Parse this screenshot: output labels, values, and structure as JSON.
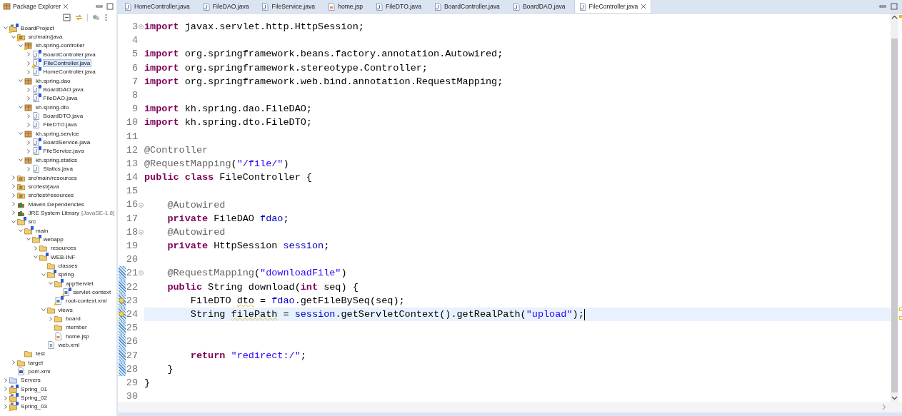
{
  "package_explorer": {
    "title": "Package Explorer",
    "tree": [
      {
        "label": "BoardProject",
        "kind": "project",
        "expanded": true,
        "selected": false,
        "spring": true,
        "warning": true,
        "children": [
          {
            "label": "src/main/java",
            "kind": "srcfolder",
            "expanded": true,
            "selected": false,
            "spring": false,
            "warning": true,
            "children": [
              {
                "label": "kh.spring.controller",
                "kind": "package",
                "expanded": true,
                "selected": false,
                "spring": false,
                "warning": true,
                "children": [
                  {
                    "label": "BoardController.java",
                    "kind": "java",
                    "expanded": false,
                    "selected": false,
                    "spring": true,
                    "warning": false
                  },
                  {
                    "label": "FileController.java",
                    "kind": "java",
                    "expanded": false,
                    "selected": true,
                    "spring": true,
                    "warning": true
                  },
                  {
                    "label": "HomeController.java",
                    "kind": "java",
                    "expanded": false,
                    "selected": false,
                    "spring": true,
                    "warning": false
                  }
                ]
              },
              {
                "label": "kh.spring.dao",
                "kind": "package",
                "expanded": true,
                "selected": false,
                "spring": false,
                "warning": false,
                "children": [
                  {
                    "label": "BoardDAO.java",
                    "kind": "java",
                    "expanded": false,
                    "selected": false,
                    "spring": true,
                    "warning": false
                  },
                  {
                    "label": "FileDAO.java",
                    "kind": "java",
                    "expanded": false,
                    "selected": false,
                    "spring": true,
                    "warning": false
                  }
                ]
              },
              {
                "label": "kh.spring.dto",
                "kind": "package",
                "expanded": true,
                "selected": false,
                "spring": false,
                "warning": false,
                "children": [
                  {
                    "label": "BoardDTO.java",
                    "kind": "java",
                    "expanded": false,
                    "selected": false,
                    "spring": false,
                    "warning": false
                  },
                  {
                    "label": "FileDTO.java",
                    "kind": "java",
                    "expanded": false,
                    "selected": false,
                    "spring": false,
                    "warning": false
                  }
                ]
              },
              {
                "label": "kh.spring.service",
                "kind": "package",
                "expanded": true,
                "selected": false,
                "spring": false,
                "warning": false,
                "children": [
                  {
                    "label": "BoardService.java",
                    "kind": "java",
                    "expanded": false,
                    "selected": false,
                    "spring": true,
                    "warning": false
                  },
                  {
                    "label": "FileService.java",
                    "kind": "java",
                    "expanded": false,
                    "selected": false,
                    "spring": true,
                    "warning": false
                  }
                ]
              },
              {
                "label": "kh.spring.statics",
                "kind": "package",
                "expanded": true,
                "selected": false,
                "spring": false,
                "warning": false,
                "children": [
                  {
                    "label": "Statics.java",
                    "kind": "java",
                    "expanded": false,
                    "selected": false,
                    "spring": false,
                    "warning": false
                  }
                ]
              }
            ]
          },
          {
            "label": "src/main/resources",
            "kind": "srcfolder",
            "expanded": false,
            "selected": false,
            "spring": false,
            "warning": false
          },
          {
            "label": "src/test/java",
            "kind": "srcfolder",
            "expanded": false,
            "selected": false,
            "spring": false,
            "warning": false
          },
          {
            "label": "src/test/resources",
            "kind": "srcfolder",
            "expanded": false,
            "selected": false,
            "spring": false,
            "warning": false
          },
          {
            "label": "Maven Dependencies",
            "kind": "library",
            "expanded": false,
            "selected": false,
            "spring": false,
            "warning": false
          },
          {
            "label": "JRE System Library",
            "decoration": "[JavaSE-1.8]",
            "kind": "library",
            "expanded": false,
            "selected": false,
            "spring": false,
            "warning": false
          },
          {
            "label": "src",
            "kind": "folder",
            "expanded": true,
            "selected": false,
            "spring": true,
            "warning": false,
            "children": [
              {
                "label": "main",
                "kind": "folder",
                "expanded": true,
                "selected": false,
                "spring": true,
                "warning": false,
                "children": [
                  {
                    "label": "webapp",
                    "kind": "folder",
                    "expanded": true,
                    "selected": false,
                    "spring": true,
                    "warning": false,
                    "children": [
                      {
                        "label": "resources",
                        "kind": "folder",
                        "expanded": false,
                        "selected": false,
                        "spring": false,
                        "warning": false
                      },
                      {
                        "label": "WEB-INF",
                        "kind": "folder",
                        "expanded": true,
                        "selected": false,
                        "spring": true,
                        "warning": false,
                        "children": [
                          {
                            "label": "classes",
                            "kind": "folder",
                            "selected": false,
                            "spring": false,
                            "warning": false
                          },
                          {
                            "label": "spring",
                            "kind": "folder",
                            "expanded": true,
                            "selected": false,
                            "spring": true,
                            "warning": false,
                            "children": [
                              {
                                "label": "appServlet",
                                "kind": "folder",
                                "expanded": true,
                                "selected": false,
                                "spring": true,
                                "warning": false,
                                "children": [
                                  {
                                    "label": "servlet-context",
                                    "kind": "xml",
                                    "selected": false,
                                    "spring": true,
                                    "warning": true
                                  }
                                ]
                              },
                              {
                                "label": "root-context.xml",
                                "kind": "xml",
                                "selected": false,
                                "spring": true,
                                "warning": true
                              }
                            ]
                          },
                          {
                            "label": "views",
                            "kind": "folder",
                            "expanded": true,
                            "selected": false,
                            "spring": false,
                            "warning": false,
                            "children": [
                              {
                                "label": "board",
                                "kind": "folder",
                                "expanded": false,
                                "selected": false,
                                "spring": false,
                                "warning": false
                              },
                              {
                                "label": "member",
                                "kind": "folder",
                                "selected": false,
                                "spring": false,
                                "warning": false
                              },
                              {
                                "label": "home.jsp",
                                "kind": "jsp",
                                "selected": false,
                                "spring": false,
                                "warning": false
                              }
                            ]
                          },
                          {
                            "label": "web.xml",
                            "kind": "webxml",
                            "selected": false,
                            "spring": false,
                            "warning": false
                          }
                        ]
                      }
                    ]
                  }
                ]
              },
              {
                "label": "test",
                "kind": "folder",
                "selected": false,
                "spring": false,
                "warning": false
              }
            ]
          },
          {
            "label": "target",
            "kind": "folder",
            "expanded": false,
            "selected": false,
            "spring": false,
            "warning": false
          },
          {
            "label": "pom.xml",
            "kind": "pom",
            "selected": false,
            "spring": false,
            "warning": false
          }
        ]
      },
      {
        "label": "Servers",
        "kind": "servers",
        "expanded": false,
        "selected": false,
        "spring": false,
        "warning": false
      },
      {
        "label": "Spring_01",
        "kind": "project",
        "expanded": false,
        "selected": false,
        "spring": true,
        "warning": true
      },
      {
        "label": "Spring_02",
        "kind": "project",
        "expanded": false,
        "selected": false,
        "spring": true,
        "warning": true
      },
      {
        "label": "Spring_03",
        "kind": "project",
        "expanded": false,
        "selected": false,
        "spring": true,
        "warning": true
      }
    ]
  },
  "editor": {
    "tabs": [
      {
        "label": "HomeController.java",
        "kind": "java",
        "selected": false
      },
      {
        "label": "FileDAO.java",
        "kind": "java",
        "selected": false
      },
      {
        "label": "FileService.java",
        "kind": "java",
        "selected": false
      },
      {
        "label": "home.jsp",
        "kind": "jsp",
        "selected": false
      },
      {
        "label": "FileDTO.java",
        "kind": "java",
        "selected": false
      },
      {
        "label": "BoardController.java",
        "kind": "java",
        "selected": false
      },
      {
        "label": "BoardDAO.java",
        "kind": "java",
        "selected": false
      },
      {
        "label": "FileController.java",
        "kind": "java",
        "selected": true
      }
    ],
    "lines": [
      {
        "number": "3",
        "fold": true,
        "changed": false,
        "warning": false,
        "current": false,
        "tokens": [
          {
            "kind": "keyword",
            "text": "import"
          },
          {
            "kind": "plain",
            "text": " javax.servlet.http.HttpSession;"
          }
        ]
      },
      {
        "number": "4",
        "fold": false,
        "changed": false,
        "warning": false,
        "current": false
      },
      {
        "number": "5",
        "fold": false,
        "changed": false,
        "warning": false,
        "current": false,
        "tokens": [
          {
            "kind": "keyword",
            "text": "import"
          },
          {
            "kind": "plain",
            "text": " org.springframework.beans.factory.annotation.Autowired;"
          }
        ]
      },
      {
        "number": "6",
        "fold": false,
        "changed": false,
        "warning": false,
        "current": false,
        "tokens": [
          {
            "kind": "keyword",
            "text": "import"
          },
          {
            "kind": "plain",
            "text": " org.springframework.stereotype.Controller;"
          }
        ]
      },
      {
        "number": "7",
        "fold": false,
        "changed": false,
        "warning": false,
        "current": false,
        "tokens": [
          {
            "kind": "keyword",
            "text": "import"
          },
          {
            "kind": "plain",
            "text": " org.springframework.web.bind.annotation.RequestMapping;"
          }
        ]
      },
      {
        "number": "8",
        "fold": false,
        "changed": false,
        "warning": false,
        "current": false
      },
      {
        "number": "9",
        "fold": false,
        "changed": false,
        "warning": false,
        "current": false,
        "tokens": [
          {
            "kind": "keyword",
            "text": "import"
          },
          {
            "kind": "plain",
            "text": " kh.spring.dao.FileDAO;"
          }
        ]
      },
      {
        "number": "10",
        "fold": false,
        "changed": false,
        "warning": false,
        "current": false,
        "tokens": [
          {
            "kind": "keyword",
            "text": "import"
          },
          {
            "kind": "plain",
            "text": " kh.spring.dto.FileDTO;"
          }
        ]
      },
      {
        "number": "11",
        "fold": false,
        "changed": false,
        "warning": false,
        "current": false
      },
      {
        "number": "12",
        "fold": false,
        "changed": false,
        "warning": false,
        "current": false,
        "tokens": [
          {
            "kind": "annotation",
            "text": "@Controller"
          }
        ]
      },
      {
        "number": "13",
        "fold": false,
        "changed": false,
        "warning": false,
        "current": false,
        "tokens": [
          {
            "kind": "annotation",
            "text": "@RequestMapping"
          },
          {
            "kind": "plain",
            "text": "("
          },
          {
            "kind": "string",
            "text": "\"/file/\""
          },
          {
            "kind": "plain",
            "text": ")"
          }
        ]
      },
      {
        "number": "14",
        "fold": false,
        "changed": false,
        "warning": false,
        "current": false,
        "tokens": [
          {
            "kind": "keyword",
            "text": "public"
          },
          {
            "kind": "keyword",
            "text": " class"
          },
          {
            "kind": "plain",
            "text": " FileController {"
          }
        ]
      },
      {
        "number": "15",
        "fold": false,
        "changed": false,
        "warning": false,
        "current": false
      },
      {
        "number": "16",
        "fold": true,
        "changed": false,
        "warning": false,
        "current": false,
        "tokens": [
          {
            "kind": "annotation",
            "text": "    @Autowired"
          }
        ]
      },
      {
        "number": "17",
        "fold": false,
        "changed": false,
        "warning": false,
        "current": false,
        "tokens": [
          {
            "kind": "keyword",
            "text": "    private"
          },
          {
            "kind": "plain",
            "text": " FileDAO "
          },
          {
            "kind": "field",
            "text": "fdao"
          },
          {
            "kind": "plain",
            "text": ";"
          }
        ]
      },
      {
        "number": "18",
        "fold": true,
        "changed": false,
        "warning": false,
        "current": false,
        "tokens": [
          {
            "kind": "annotation",
            "text": "    @Autowired"
          }
        ]
      },
      {
        "number": "19",
        "fold": false,
        "changed": false,
        "warning": false,
        "current": false,
        "tokens": [
          {
            "kind": "keyword",
            "text": "    private"
          },
          {
            "kind": "plain",
            "text": " HttpSession "
          },
          {
            "kind": "field",
            "text": "session"
          },
          {
            "kind": "plain",
            "text": ";"
          }
        ]
      },
      {
        "number": "20",
        "fold": false,
        "changed": false,
        "warning": false,
        "current": false
      },
      {
        "number": "21",
        "fold": true,
        "changed": true,
        "warning": false,
        "current": false,
        "tokens": [
          {
            "kind": "annotation",
            "text": "    @RequestMapping"
          },
          {
            "kind": "plain",
            "text": "("
          },
          {
            "kind": "string",
            "text": "\"downloadFile\""
          },
          {
            "kind": "plain",
            "text": ")"
          }
        ]
      },
      {
        "number": "22",
        "fold": false,
        "changed": true,
        "warning": false,
        "current": false,
        "tokens": [
          {
            "kind": "keyword",
            "text": "    public"
          },
          {
            "kind": "plain",
            "text": " String download("
          },
          {
            "kind": "keyword",
            "text": "int"
          },
          {
            "kind": "plain",
            "text": " seq) {"
          }
        ]
      },
      {
        "number": "23",
        "fold": false,
        "changed": true,
        "warning": true,
        "current": false,
        "tokens": [
          {
            "kind": "plain",
            "text": "        FileDTO "
          },
          {
            "kind": "unused",
            "text": "dto"
          },
          {
            "kind": "plain",
            "text": " = "
          },
          {
            "kind": "field",
            "text": "fdao"
          },
          {
            "kind": "plain",
            "text": ".getFileBySeq(seq);"
          }
        ]
      },
      {
        "number": "24",
        "fold": false,
        "changed": true,
        "warning": true,
        "current": true,
        "tokens": [
          {
            "kind": "plain",
            "text": "        String "
          },
          {
            "kind": "unused",
            "text": "filePath"
          },
          {
            "kind": "plain",
            "text": " = "
          },
          {
            "kind": "field",
            "text": "session"
          },
          {
            "kind": "plain",
            "text": ".getServletContext().getRealPath("
          },
          {
            "kind": "string",
            "text": "\"upload\""
          },
          {
            "kind": "plain",
            "text": ");"
          }
        ]
      },
      {
        "number": "25",
        "fold": false,
        "changed": true,
        "warning": false,
        "current": false
      },
      {
        "number": "26",
        "fold": false,
        "changed": true,
        "warning": false,
        "current": false
      },
      {
        "number": "27",
        "fold": false,
        "changed": true,
        "warning": false,
        "current": false,
        "tokens": [
          {
            "kind": "keyword",
            "text": "        return"
          },
          {
            "kind": "string",
            "text": " \"redirect:/\""
          },
          {
            "kind": "plain",
            "text": ";"
          }
        ]
      },
      {
        "number": "28",
        "fold": false,
        "changed": true,
        "warning": false,
        "current": false,
        "tokens": [
          {
            "kind": "plain",
            "text": "    }"
          }
        ]
      },
      {
        "number": "29",
        "fold": false,
        "changed": false,
        "warning": false,
        "current": false,
        "tokens": [
          {
            "kind": "plain",
            "text": "}"
          }
        ]
      },
      {
        "number": "30",
        "fold": false,
        "changed": false,
        "warning": false,
        "current": false
      }
    ]
  }
}
